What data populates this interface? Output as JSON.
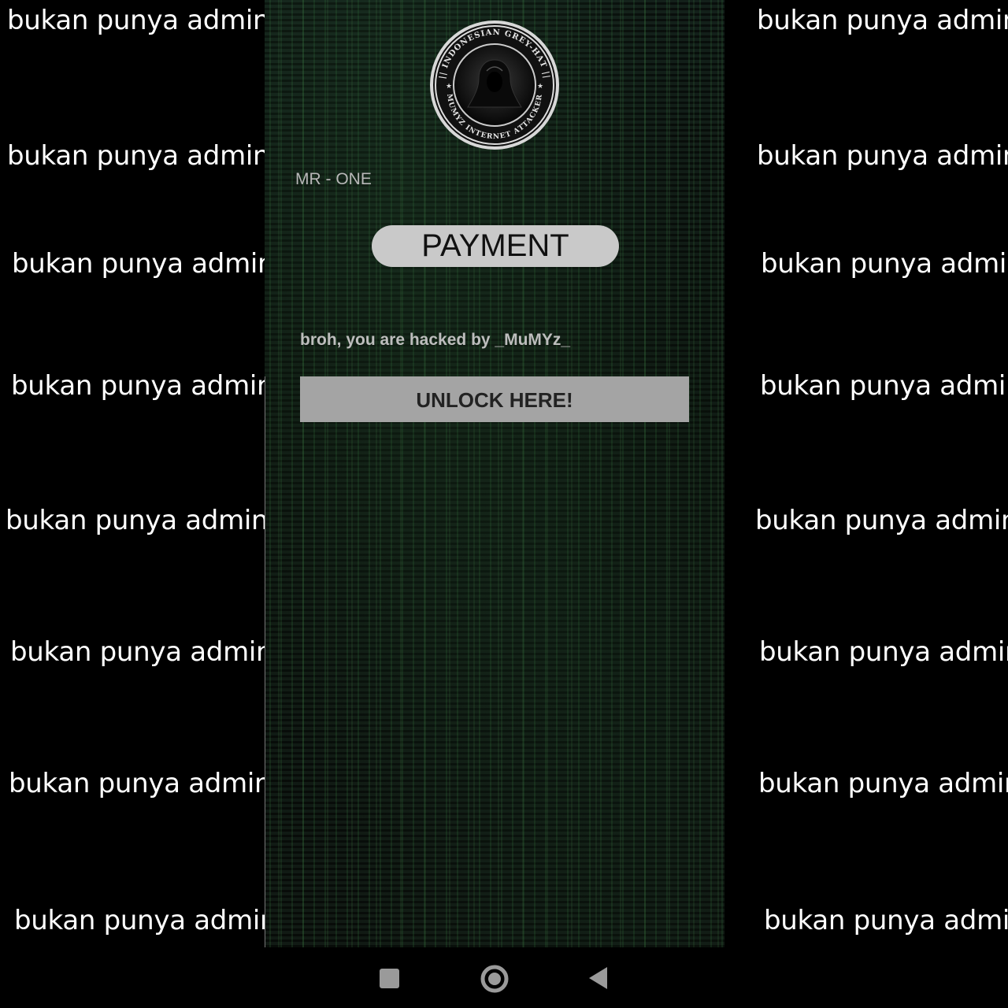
{
  "watermark": {
    "text": "bukan punya admin"
  },
  "screen": {
    "logo": {
      "icon": "hooded-figure-seal-icon",
      "ring_top_text": "|| INDONESIAN GREY-HAT ||",
      "ring_bottom_text": "|| MUMYZ INTERNET ATTACKER ||"
    },
    "mr_one_label": "MR - ONE",
    "payment_label": "PAYMENT",
    "hacked_message": "broh, you are hacked by _MuMYz_",
    "unlock_label": "UNLOCK HERE!"
  },
  "navbar": {
    "recents_icon": "square-icon",
    "home_icon": "circle-icon",
    "back_icon": "triangle-back-icon"
  },
  "colors": {
    "background": "#000000",
    "watermark_text": "#ffffff",
    "payment_button": "#c9c9c9",
    "unlock_button": "#a4a4a4",
    "matrix_green": "#3c8c46"
  }
}
